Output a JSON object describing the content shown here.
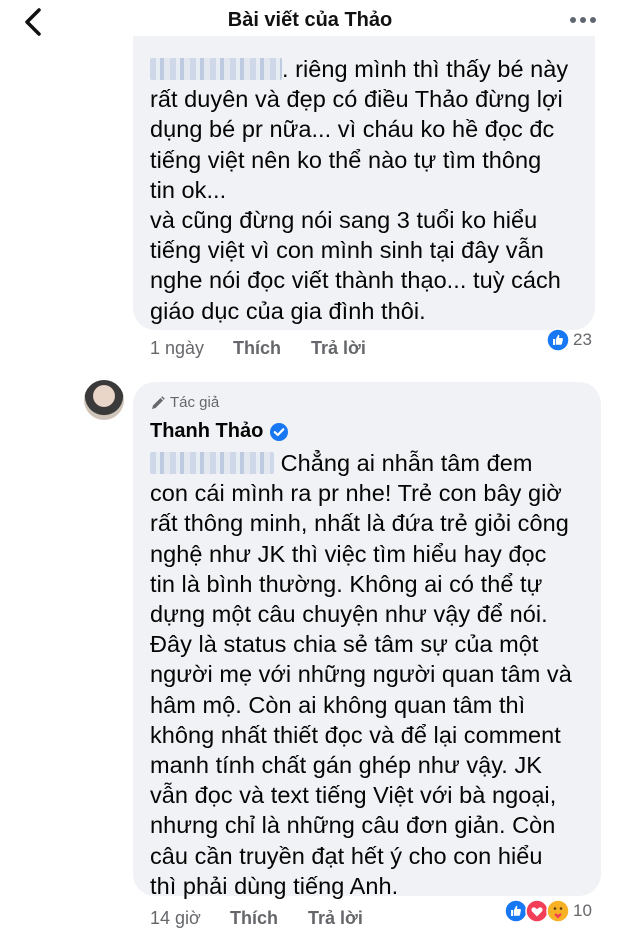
{
  "header": {
    "title": "Bài viết của Thảo"
  },
  "comment1": {
    "lines": [
      ". riêng mình thì thấy bé này",
      "rất duyên và đẹp có điều Thảo đừng lợi",
      "dụng bé pr nữa... vì cháu ko hề đọc đc",
      "tiếng việt nên ko thể nào tự tìm thông",
      "tin ok...",
      "và cũng đừng nói sang 3 tuổi ko hiểu",
      "tiếng việt vì con mình sinh tại đây vẫn",
      "nghe nói đọc viết thành thạo... tuỳ cách",
      "giáo dục của gia đình thôi."
    ],
    "time": "1 ngày",
    "like_label": "Thích",
    "reply_label": "Trả lời",
    "reaction_count": "23",
    "reaction_icons": [
      "like-reaction-icon"
    ]
  },
  "comment2": {
    "author_badge": "Tác giả",
    "author_name": "Thanh Thảo",
    "lines": [
      "Chẳng ai nhẫn tâm đem",
      "con cái mình ra pr nhe! Trẻ con bây giờ",
      "rất thông minh, nhất là đứa trẻ giỏi công",
      "nghệ như JK thì việc tìm hiểu hay đọc",
      "tin là bình thường. Không ai có thể tự",
      "dựng một câu chuyện như vậy để nói.",
      "Đây là status chia sẻ tâm sự của một",
      "người mẹ với những người quan tâm và",
      "hâm mộ. Còn ai không quan tâm thì",
      "không nhất thiết đọc và để lại comment",
      "manh tính chất gán ghép như vậy. JK",
      "vẫn đọc và text tiếng Việt với bà ngoại,",
      "nhưng chỉ là những câu đơn giản. Còn",
      "câu cần truyền đạt hết ý cho con hiểu",
      "thì phải dùng tiếng Anh."
    ],
    "time": "14 giờ",
    "like_label": "Thích",
    "reply_label": "Trả lời",
    "reaction_count": "10",
    "reaction_icons": [
      "like-reaction-icon",
      "love-reaction-icon",
      "care-reaction-icon"
    ]
  },
  "colors": {
    "bubble": "#f0f2f5",
    "meta_text": "#65676b",
    "like_blue": "#1877f2",
    "love_red": "#f33e58",
    "verified_blue": "#1877f2"
  }
}
